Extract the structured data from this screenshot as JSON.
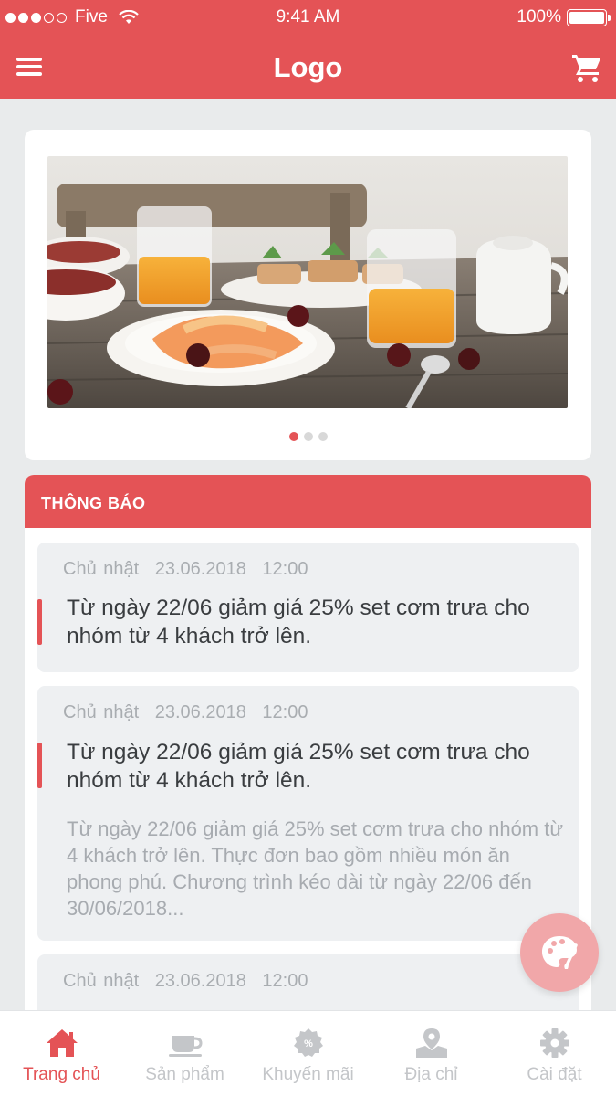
{
  "status": {
    "carrier": "Five",
    "time": "9:41 AM",
    "battery": "100%"
  },
  "header": {
    "logo": "Logo",
    "menu_icon": "hamburger-icon",
    "cart_icon": "cart-icon"
  },
  "banner": {
    "pages": 3,
    "active_page": 1
  },
  "notices": {
    "title": "THÔNG BÁO",
    "items": [
      {
        "day": "Chủ nhật",
        "date": "23.06.2018",
        "time": "12:00",
        "title": "Từ ngày 22/06 giảm giá 25% set cơm trưa cho nhóm từ 4 khách trở lên.",
        "body": ""
      },
      {
        "day": "Chủ nhật",
        "date": "23.06.2018",
        "time": "12:00",
        "title": "Từ ngày 22/06 giảm giá 25% set cơm trưa cho nhóm từ 4 khách trở lên.",
        "body": "Từ ngày 22/06 giảm giá 25% set cơm trưa cho nhóm từ 4 khách trở lên. Thực đơn bao gồm nhiều món ăn phong phú. Chương trình kéo dài từ ngày 22/06 đến  30/06/2018..."
      },
      {
        "day": "Chủ nhật",
        "date": "23.06.2018",
        "time": "12:00",
        "title": "",
        "body": ""
      }
    ]
  },
  "tabs": [
    {
      "label": "Trang chủ",
      "icon": "home-icon",
      "active": true
    },
    {
      "label": "Sản phẩm",
      "icon": "coffee-cup-icon",
      "active": false
    },
    {
      "label": "Khuyến mãi",
      "icon": "percent-badge-icon",
      "active": false
    },
    {
      "label": "Địa chỉ",
      "icon": "map-pin-icon",
      "active": false
    },
    {
      "label": "Cài đặt",
      "icon": "gear-icon",
      "active": false
    }
  ],
  "colors": {
    "accent": "#e45356",
    "fab": "#f1a7a9",
    "background": "#e9ebec"
  }
}
